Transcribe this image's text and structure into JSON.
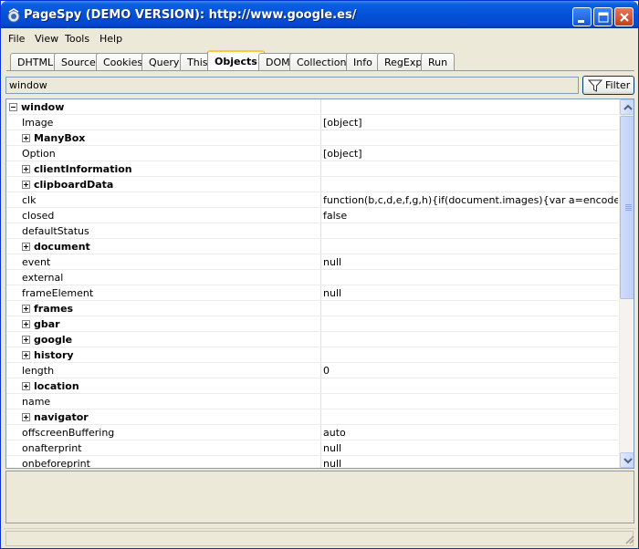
{
  "window": {
    "title": "PageSpy (DEMO VERSION): http://www.google.es/"
  },
  "menu": [
    "File",
    "View",
    "Tools",
    "Help"
  ],
  "tabs": [
    "DHTML",
    "Source",
    "Cookies",
    "Query",
    "This",
    "Objects",
    "DOM",
    "Collections",
    "Info",
    "RegExp",
    "Run"
  ],
  "active_tab": "Objects",
  "filter": {
    "value": "window",
    "button_label": "Filter"
  },
  "tree": {
    "root": "window",
    "rows": [
      {
        "name": "Image",
        "value": "[object]",
        "expandable": false
      },
      {
        "name": "ManyBox",
        "value": "",
        "expandable": true
      },
      {
        "name": "Option",
        "value": "[object]",
        "expandable": false
      },
      {
        "name": "clientInformation",
        "value": "",
        "expandable": true
      },
      {
        "name": "clipboardData",
        "value": "",
        "expandable": true
      },
      {
        "name": "clk",
        "value": "function(b,c,d,e,f,g,h){if(document.images){var a=encodeURICon",
        "expandable": false
      },
      {
        "name": "closed",
        "value": "false",
        "expandable": false
      },
      {
        "name": "defaultStatus",
        "value": "",
        "expandable": false
      },
      {
        "name": "document",
        "value": "",
        "expandable": true
      },
      {
        "name": "event",
        "value": "null",
        "expandable": false
      },
      {
        "name": "external",
        "value": "",
        "expandable": false
      },
      {
        "name": "frameElement",
        "value": "null",
        "expandable": false
      },
      {
        "name": "frames",
        "value": "",
        "expandable": true
      },
      {
        "name": "gbar",
        "value": "",
        "expandable": true
      },
      {
        "name": "google",
        "value": "",
        "expandable": true
      },
      {
        "name": "history",
        "value": "",
        "expandable": true
      },
      {
        "name": "length",
        "value": "0",
        "expandable": false
      },
      {
        "name": "location",
        "value": "",
        "expandable": true
      },
      {
        "name": "name",
        "value": "",
        "expandable": false
      },
      {
        "name": "navigator",
        "value": "",
        "expandable": true
      },
      {
        "name": "offscreenBuffering",
        "value": "auto",
        "expandable": false
      },
      {
        "name": "onafterprint",
        "value": "null",
        "expandable": false
      },
      {
        "name": "onbeforeprint",
        "value": "null",
        "expandable": false
      }
    ]
  },
  "colors": {
    "titlebar": "#0451d9",
    "active_tab_accent": "#ffc83c",
    "scrollbar": "#c4d4fa"
  }
}
